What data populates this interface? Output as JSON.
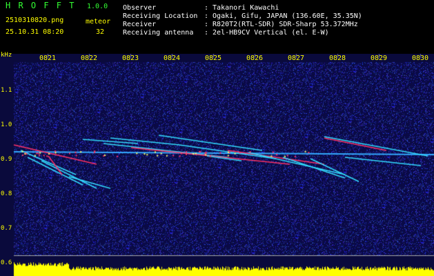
{
  "header": {
    "app_name": "H R O F F T",
    "version": "1.0.0",
    "filename": "2510310820.png",
    "datetime": "25.10.31 08:20",
    "meteor_label": "meteor",
    "meteor_count": "32",
    "observer_label": "Observer",
    "observer_value": ": Takanori Kawachi",
    "location_label": "Receiving Location",
    "location_value": ": Ogaki, Gifu, JAPAN (136.60E, 35.35N)",
    "receiver_label": "Receiver",
    "receiver_value": ": R820T2(RTL-SDR) SDR-Sharp 53.372MHz",
    "antenna_label": "Receiving antenna",
    "antenna_value": ": 2el-HB9CV Vertical (el. E-W)"
  },
  "plot": {
    "y_unit": "kHz",
    "y_ticks": [
      "1.1",
      "1.0",
      "0.9",
      "0.8",
      "0.7",
      "0.6"
    ],
    "x_ticks": [
      "0821",
      "0822",
      "0823",
      "0824",
      "0825",
      "0826",
      "0827",
      "0828",
      "0829",
      "0830"
    ],
    "colors": {
      "background": "#0a0a3c",
      "carrier": "#33aaff",
      "echo": "#33ddff",
      "hot": "#ff3366",
      "level": "#ffff00",
      "tick_text": "#ffff00"
    }
  }
}
